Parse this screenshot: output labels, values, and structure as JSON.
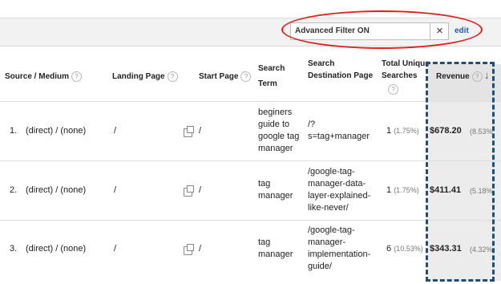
{
  "filter": {
    "text": "Advanced Filter ON",
    "clear_icon": "×",
    "edit_label": "edit"
  },
  "columns": {
    "source_medium": "Source / Medium",
    "landing_page": "Landing Page",
    "start_page": "Start Page",
    "search_term": [
      "Search",
      "Term"
    ],
    "search_destination": [
      "Search",
      "Destination Page"
    ],
    "total_unique": [
      "Total Unique",
      "Searches"
    ],
    "revenue": "Revenue",
    "help_icon": "?",
    "sort_icon": "↓"
  },
  "rows": [
    {
      "index": "1.",
      "source": "(direct) / (none)",
      "landing": "/",
      "start": "/",
      "term": [
        "beginers",
        "guide to",
        "google tag",
        "manager"
      ],
      "dest": [
        "/?",
        "s=tag+manager"
      ],
      "searches": "1",
      "searches_pct": "(1.75%)",
      "revenue": "$678.20",
      "revenue_pct": "(8.53%"
    },
    {
      "index": "2.",
      "source": "(direct) / (none)",
      "landing": "/",
      "start": "/",
      "term": [
        "tag",
        "manager"
      ],
      "dest": [
        "/google-tag-",
        "manager-data-",
        "layer-explained-",
        "like-never/"
      ],
      "searches": "1",
      "searches_pct": "(1.75%)",
      "revenue": "$411.41",
      "revenue_pct": "(5.18%"
    },
    {
      "index": "3.",
      "source": "(direct) / (none)",
      "landing": "/",
      "start": "/",
      "term": [
        "tag",
        "manager"
      ],
      "dest": [
        "/google-tag-",
        "manager-",
        "implementation-",
        "guide/"
      ],
      "searches": "6",
      "searches_pct": "(10.53%)",
      "revenue": "$343.31",
      "revenue_pct": "(4.32%"
    }
  ]
}
